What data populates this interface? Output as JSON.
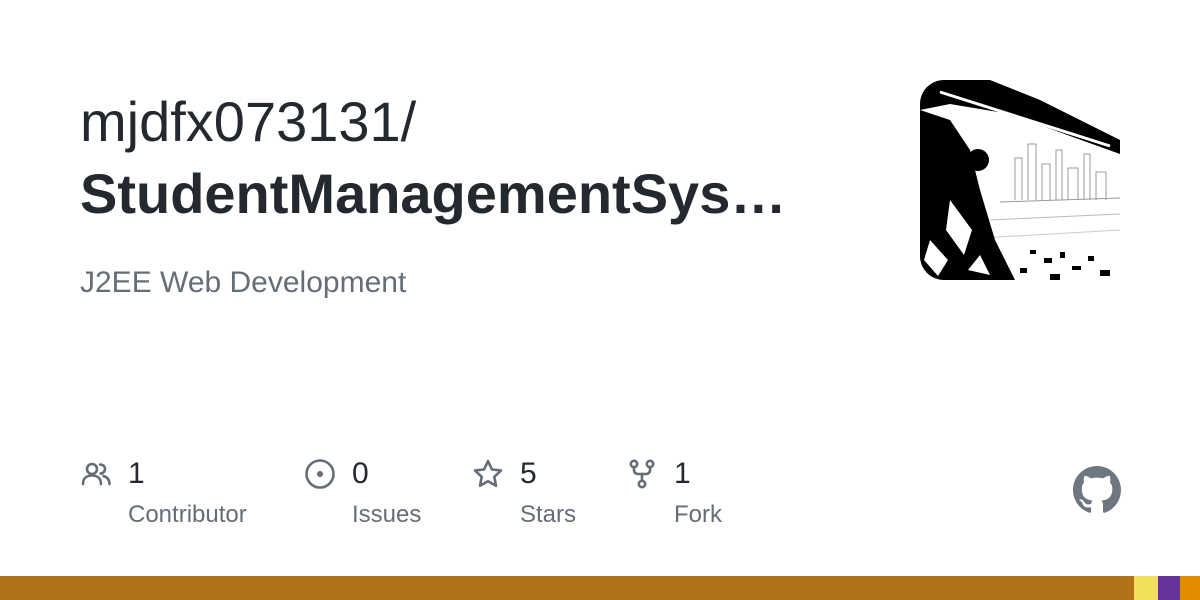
{
  "header": {
    "owner": "mjdfx073131/",
    "repo": "StudentManagementSys…",
    "description": "J2EE Web Development"
  },
  "stats": [
    {
      "icon": "people-icon",
      "count": "1",
      "label": "Contributor"
    },
    {
      "icon": "issue-icon",
      "count": "0",
      "label": "Issues"
    },
    {
      "icon": "star-icon",
      "count": "5",
      "label": "Stars"
    },
    {
      "icon": "fork-icon",
      "count": "1",
      "label": "Fork"
    }
  ],
  "branding": {
    "logo": "github-icon",
    "logo_color": "#6e7681"
  },
  "language_bar": {
    "colors": [
      "#b07219",
      "#f1e05a",
      "#663399",
      "#e38c00"
    ],
    "shares": [
      0.945,
      0.02,
      0.018,
      0.017
    ]
  },
  "colors": {
    "title": "#24292f",
    "muted": "#656d76"
  }
}
